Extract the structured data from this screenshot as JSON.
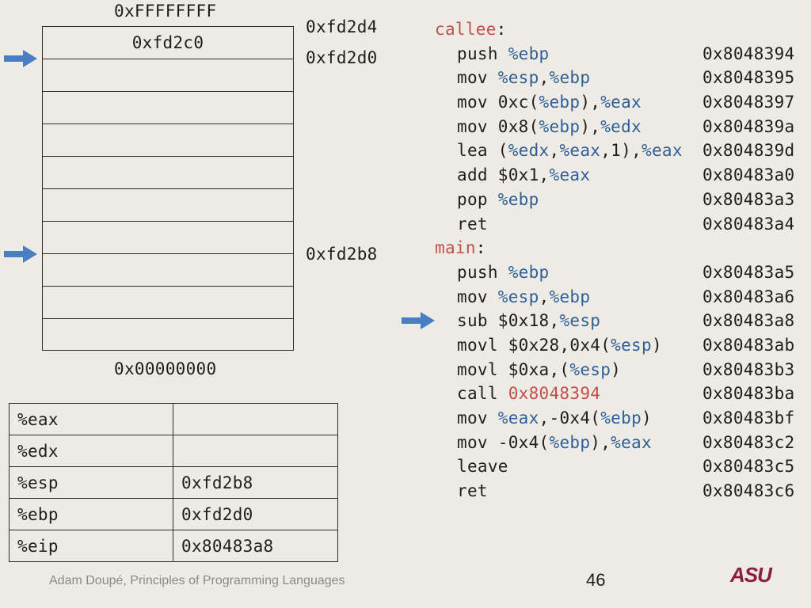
{
  "stack": {
    "top_label": "0xFFFFFFFF",
    "bottom_label": "0x00000000",
    "cells": [
      "0xfd2c0",
      "",
      "",
      "",
      "",
      "",
      "",
      "",
      "",
      ""
    ],
    "address_labels": [
      "0xfd2d4",
      "0xfd2d0",
      "0xfd2b8"
    ]
  },
  "registers": [
    {
      "name": "%eax",
      "value": ""
    },
    {
      "name": "%edx",
      "value": ""
    },
    {
      "name": "%esp",
      "value": "0xfd2b8"
    },
    {
      "name": "%ebp",
      "value": "0xfd2d0"
    },
    {
      "name": "%eip",
      "value": "0x80483a8"
    }
  ],
  "code": {
    "callee_label": "callee",
    "main_label": "main",
    "callee": [
      {
        "addr": "0x8048394"
      },
      {
        "addr": "0x8048395"
      },
      {
        "addr": "0x8048397"
      },
      {
        "addr": "0x804839a"
      },
      {
        "addr": "0x804839d"
      },
      {
        "addr": "0x80483a0"
      },
      {
        "addr": "0x80483a3"
      },
      {
        "addr": "0x80483a4"
      }
    ],
    "main": [
      {
        "addr": "0x80483a5"
      },
      {
        "addr": "0x80483a6"
      },
      {
        "addr": "0x80483a8"
      },
      {
        "addr": "0x80483ab"
      },
      {
        "addr": "0x80483b3"
      },
      {
        "addr": "0x80483ba"
      },
      {
        "addr": "0x80483bf"
      },
      {
        "addr": "0x80483c2"
      },
      {
        "addr": "0x80483c5"
      },
      {
        "addr": "0x80483c6"
      }
    ]
  },
  "footer": "Adam Doupé, Principles of Programming Languages",
  "page_number": "46",
  "logo_text": "ASU",
  "colors": {
    "arrow": "#4a7ec2",
    "label": "#c0504d",
    "register": "#2f5f98"
  }
}
